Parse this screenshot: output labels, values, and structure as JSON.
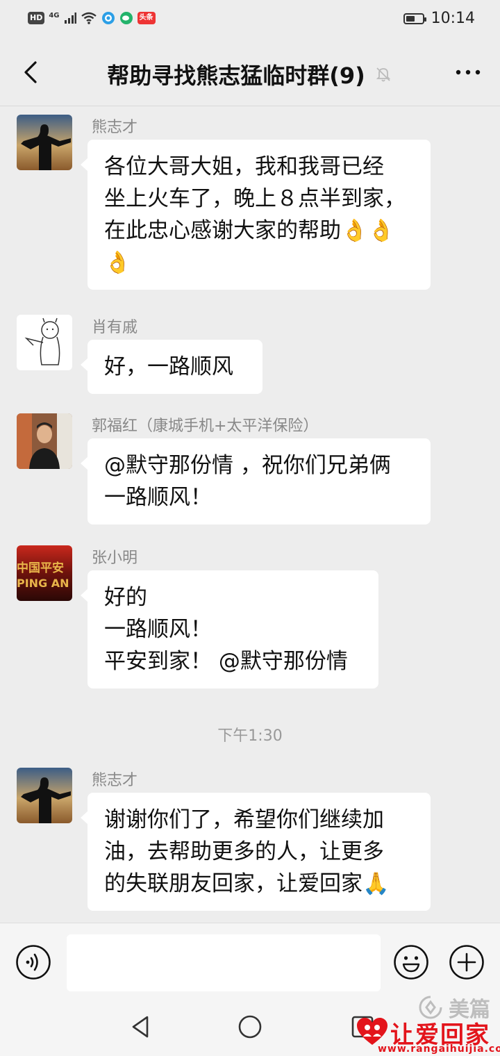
{
  "status_bar": {
    "hd": "HD",
    "network": "4G",
    "toutiao": "头条",
    "time": "10:14",
    "battery_level_percent": 55
  },
  "header": {
    "title": "帮助寻找熊志猛临时群(9)"
  },
  "messages": [
    {
      "sender": "熊志才",
      "lines": [
        "各位大哥大姐，我和我哥已经",
        "坐上火车了，晚上８点半到家，",
        "在此忠心感谢大家的帮助👌👌",
        "👌"
      ]
    },
    {
      "sender": "肖有戚",
      "lines": [
        "好，一路顺风"
      ]
    },
    {
      "sender": "郭福红（康城手机+太平洋保险）",
      "lines": [
        "@默守那份情 ，祝你们兄弟俩",
        "一路顺风！"
      ]
    },
    {
      "sender": "张小明",
      "lines": [
        "好的",
        "一路顺风！",
        "平安到家！ @默守那份情"
      ]
    }
  ],
  "timestamp": "下午1:30",
  "messages_after": [
    {
      "sender": "熊志才",
      "lines": [
        "谢谢你们了，希望你们继续加",
        "油，去帮助更多的人，让更多",
        "的失联朋友回家，让爱回家🙏"
      ]
    }
  ],
  "avatar_texts": {
    "zhang_top": "中国平安",
    "zhang_bottom": "PING AN"
  },
  "watermark": {
    "meipian": "美篇",
    "brand": "让爱回家",
    "url": "www.rangaihuijia.com"
  },
  "colors": {
    "background": "#ededed",
    "bubble": "#ffffff",
    "watermark_red": "#e3141b"
  }
}
